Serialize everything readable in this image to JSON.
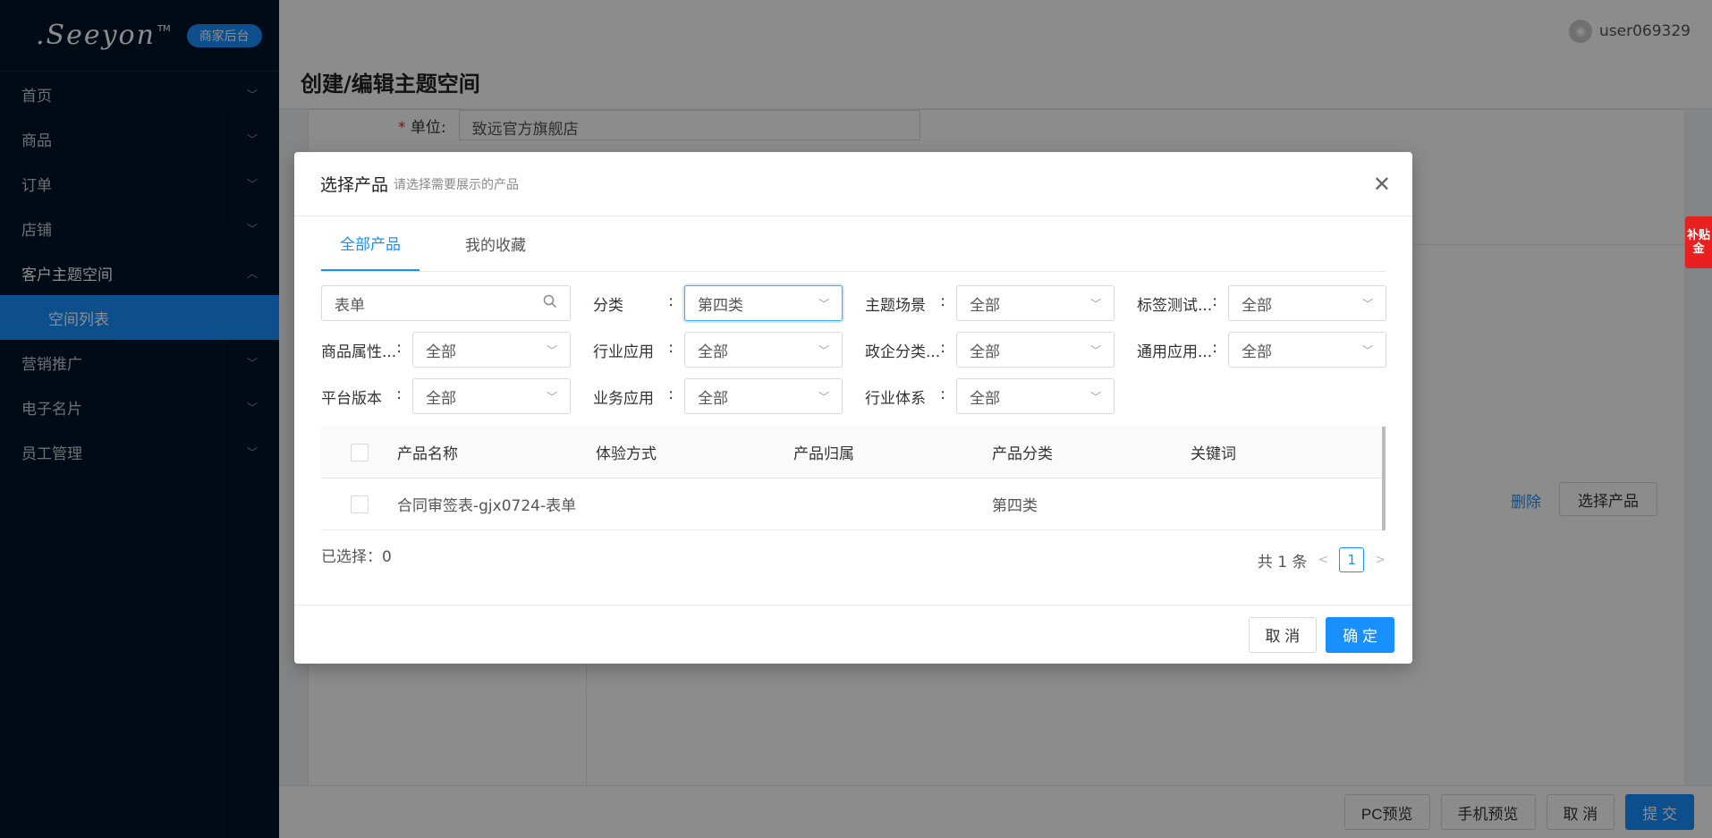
{
  "brand": {
    "logo": ".Seeyon",
    "tm": "TM",
    "badge": "商家后台"
  },
  "sidebar": {
    "items": [
      {
        "label": "首页"
      },
      {
        "label": "商品"
      },
      {
        "label": "订单"
      },
      {
        "label": "店铺"
      },
      {
        "label": "客户主题空间",
        "sub": "空间列表"
      },
      {
        "label": "营销推广"
      },
      {
        "label": "电子名片"
      },
      {
        "label": "员工管理"
      }
    ]
  },
  "header": {
    "user": "user069329",
    "title": "创建/编辑主题空间"
  },
  "form": {
    "unit_label": "单位:",
    "unit_value": "致远官方旗舰店",
    "delete": "删除",
    "select_product": "选择产品"
  },
  "bottom": {
    "pc_preview": "PC预览",
    "mobile_preview": "手机预览",
    "cancel": "取 消",
    "submit": "提 交"
  },
  "side_tag": "补贴金",
  "modal": {
    "title": "选择产品",
    "subtitle": "请选择需要展示的产品",
    "tabs": [
      "全部产品",
      "我的收藏"
    ],
    "search_value": "表单",
    "filters": {
      "category": {
        "label": "分类",
        "value": "第四类"
      },
      "theme_scene": {
        "label": "主题场景",
        "value": "全部"
      },
      "tag_test": {
        "label": "标签测试...",
        "value": "全部"
      },
      "product_attr": {
        "label": "商品属性...",
        "value": "全部"
      },
      "industry_app": {
        "label": "行业应用",
        "value": "全部"
      },
      "gov_category": {
        "label": "政企分类...",
        "value": "全部"
      },
      "general_app": {
        "label": "通用应用...",
        "value": "全部"
      },
      "platform_version": {
        "label": "平台版本",
        "value": "全部"
      },
      "business_app": {
        "label": "业务应用",
        "value": "全部"
      },
      "industry_system": {
        "label": "行业体系",
        "value": "全部"
      }
    },
    "table": {
      "headers": [
        "产品名称",
        "体验方式",
        "产品归属",
        "产品分类",
        "关键词"
      ],
      "rows": [
        {
          "name": "合同审签表-gjx0724-表单",
          "mode": "",
          "owner": "",
          "category": "第四类",
          "keywords": ""
        }
      ]
    },
    "selected": "已选择：0",
    "total": "共 1 条",
    "page": "1",
    "cancel": "取 消",
    "confirm": "确 定"
  }
}
